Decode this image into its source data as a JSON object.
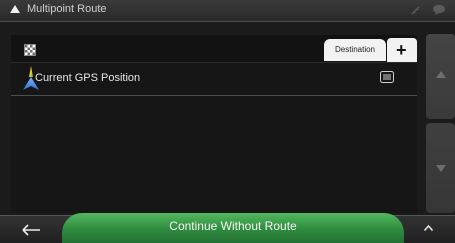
{
  "header": {
    "title": "Multipoint Route"
  },
  "route": {
    "destination_label": "Destination",
    "items": [
      {
        "label": "Current GPS Position"
      }
    ]
  },
  "footer": {
    "continue_label": "Continue Without Route"
  },
  "colors": {
    "accent_green": "#2f8b3f",
    "background": "#1b1b1b"
  },
  "icons": {
    "back": "arrow-left-icon",
    "add": "plus-icon",
    "checkered": "checkered-flag-icon",
    "nav": "navigation-arrow-icon",
    "menu": "list-menu-icon",
    "expand": "chevron-up-icon"
  }
}
